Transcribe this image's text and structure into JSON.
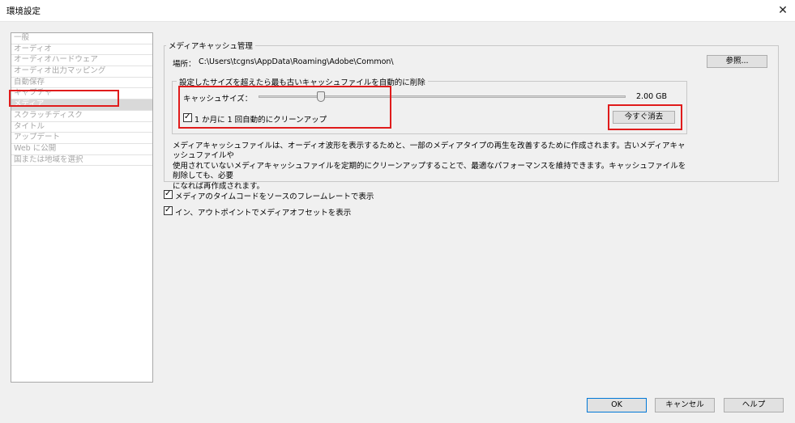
{
  "window": {
    "title": "環境設定"
  },
  "sidebar": {
    "items": [
      {
        "label": "一般"
      },
      {
        "label": "オーディオ"
      },
      {
        "label": "オーディオハードウェア"
      },
      {
        "label": "オーディオ出力マッピング"
      },
      {
        "label": "自動保存"
      },
      {
        "label": "キャプチャ"
      },
      {
        "label": "メディア",
        "selected": true
      },
      {
        "label": "スクラッチディスク"
      },
      {
        "label": "タイトル"
      },
      {
        "label": "アップデート"
      },
      {
        "label": "Web に公開"
      },
      {
        "label": "国または地域を選択"
      }
    ]
  },
  "media_cache": {
    "group_title": "メディアキャッシュ管理",
    "location_label": "場所：",
    "location_path": "C:\\Users\\tcgns\\AppData\\Roaming\\Adobe\\Common\\",
    "browse_button": "参照...",
    "auto_delete_group_title": "設定したサイズを超えたら最も古いキャッシュファイルを自動的に削除",
    "cache_size_label": "キャッシュサイズ：",
    "cache_size_value": "2.00 GB",
    "cache_slider_position": 0.17,
    "monthly_cleanup_label": "1 か月に 1 回自動的にクリーンアップ",
    "monthly_cleanup_checked": true,
    "delete_now_button": "今すぐ消去",
    "description_lines": [
      "メディアキャッシュファイルは、オーディオ波形を表示するためと、一部のメディアタイプの再生を改善するために作成されます。古いメディアキャッシュファイルや",
      "使用されていないメディアキャッシュファイルを定期的にクリーンアップすることで、最適なパフォーマンスを維持できます。キャッシュファイルを削除しても、必要",
      "になれば再作成されます。"
    ]
  },
  "options": {
    "show_timecode_label": "メディアのタイムコードをソースのフレームレートで表示",
    "show_timecode_checked": true,
    "show_offset_label": "イン、アウトポイントでメディアオフセットを表示",
    "show_offset_checked": true
  },
  "footer": {
    "ok": "OK",
    "cancel": "キャンセル",
    "help": "ヘルプ"
  },
  "colors": {
    "highlight": "#e01b1b",
    "default_button_border": "#0078d7"
  }
}
